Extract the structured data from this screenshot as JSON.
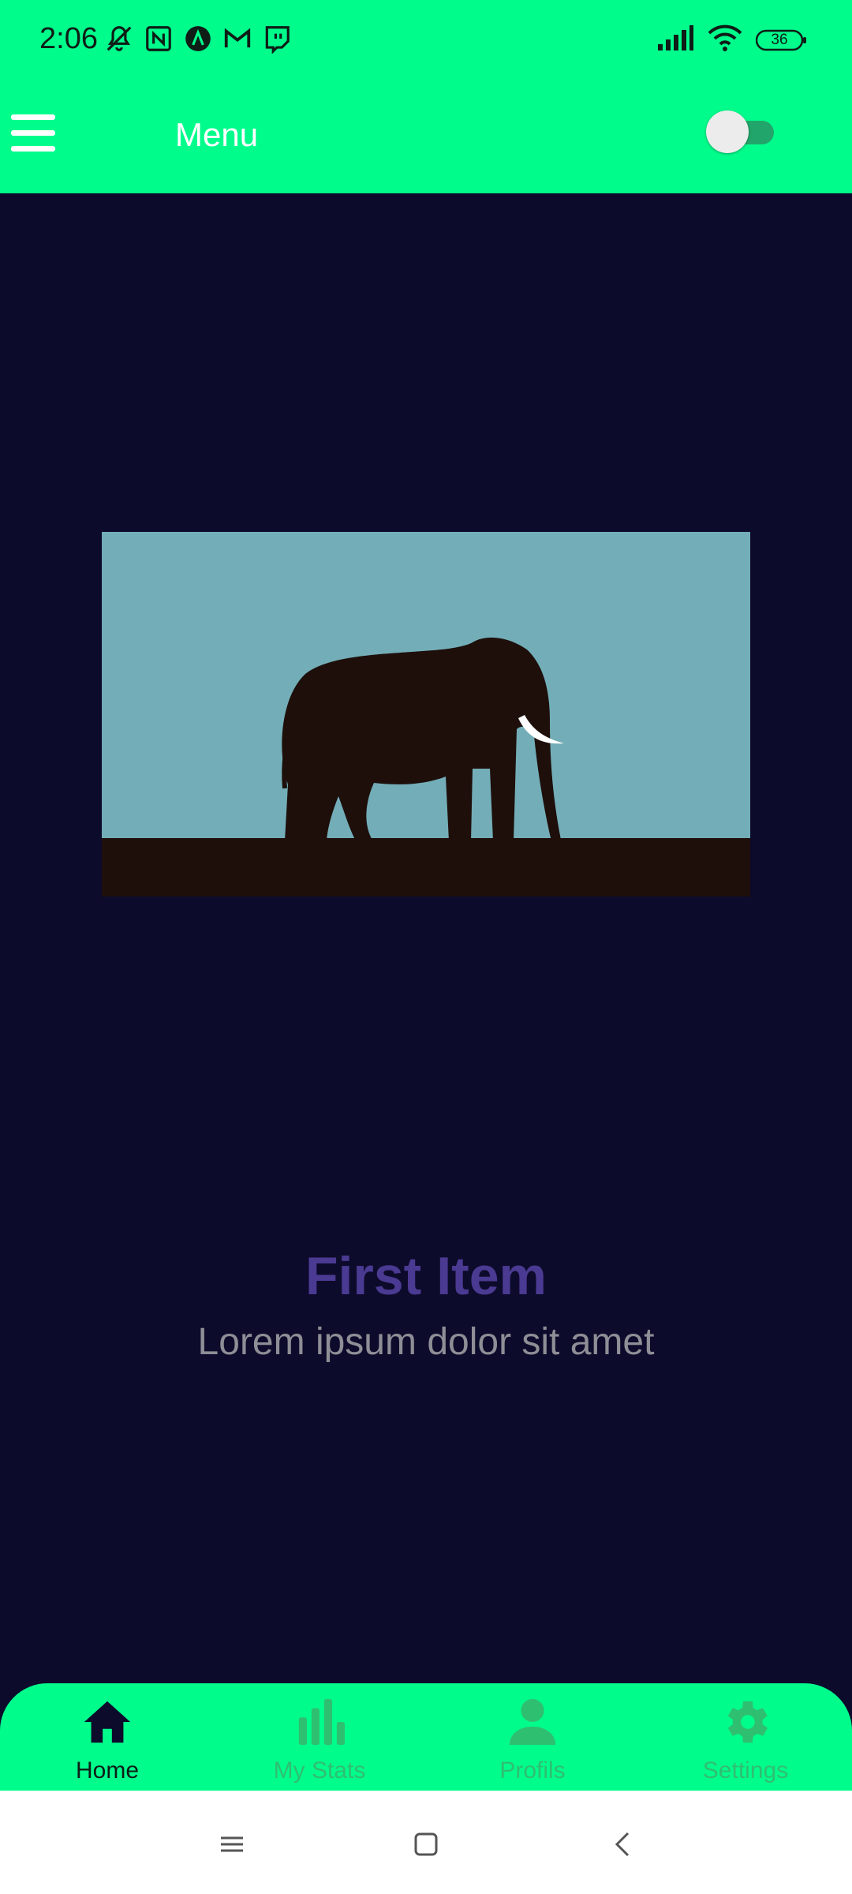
{
  "status_bar": {
    "time": "2:06",
    "battery": "36",
    "notification_icons": [
      "mute-icon",
      "nfc-icon",
      "app-a-icon",
      "gmail-icon",
      "twitch-icon"
    ]
  },
  "app_bar": {
    "title": "Menu",
    "toggle_on": false,
    "background": "#00fd8c"
  },
  "content": {
    "title": "First Item",
    "subtitle": "Lorem ipsum dolor sit amet"
  },
  "bottom_nav": {
    "items": [
      {
        "label": "Home",
        "icon": "home-icon",
        "active": true
      },
      {
        "label": "My Stats",
        "icon": "bar-chart-icon",
        "active": false
      },
      {
        "label": "Profils",
        "icon": "person-icon",
        "active": false
      },
      {
        "label": "Settings",
        "icon": "gear-icon",
        "active": false
      }
    ]
  },
  "colors": {
    "accent": "#00fd8c",
    "background": "#0d0b2b",
    "title": "#4a3a92"
  }
}
